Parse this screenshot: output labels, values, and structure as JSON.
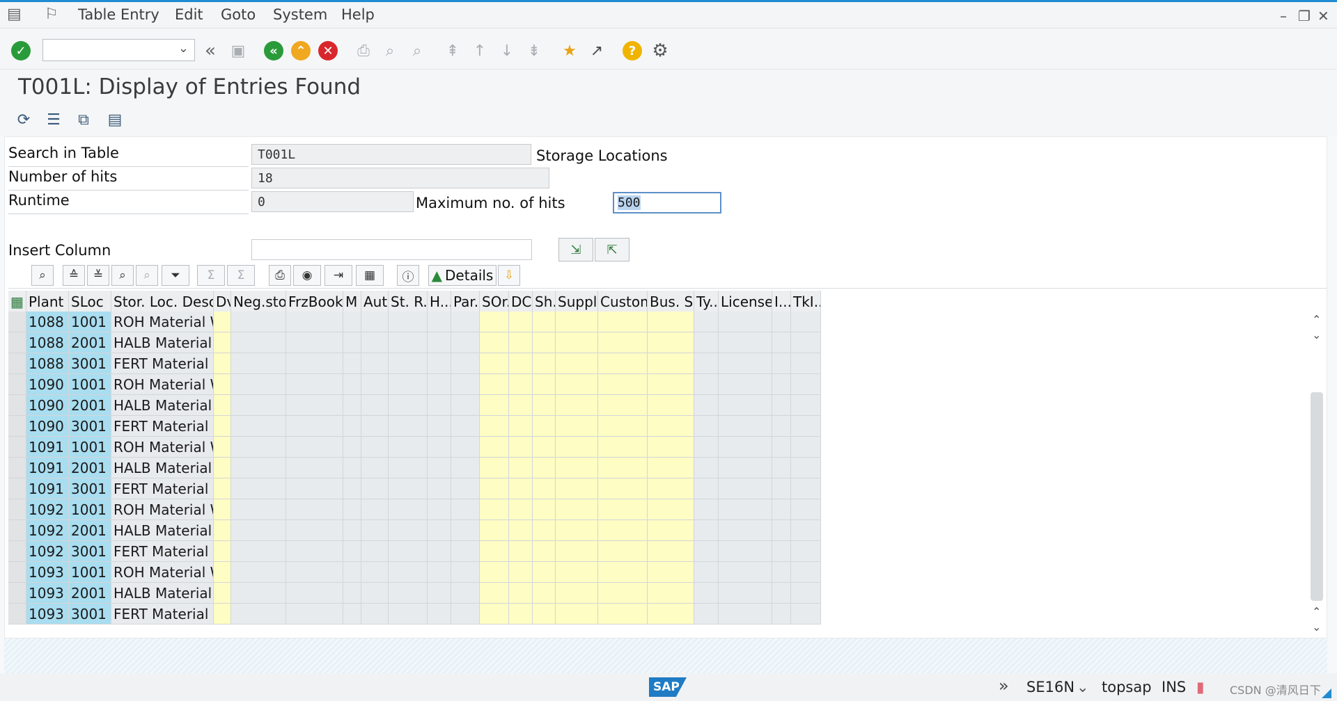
{
  "menubar": {
    "items": [
      "Table Entry",
      "Edit",
      "Goto",
      "System",
      "Help"
    ]
  },
  "window_controls": {
    "minimize": "–",
    "restore": "❐",
    "close": "✕"
  },
  "toolbar": {
    "command_field_value": ""
  },
  "title": "T001L: Display of Entries Found",
  "selection": {
    "search_label": "Search in Table",
    "search_value": "T001L",
    "search_desc": "Storage Locations",
    "hits_label": "Number of hits",
    "hits_value": "18",
    "runtime_label": "Runtime",
    "runtime_value": "0",
    "max_label": "Maximum no. of hits",
    "max_value": "500",
    "insert_label": "Insert Column"
  },
  "alv_toolbar": {
    "details_label": "Details"
  },
  "grid": {
    "columns": [
      "Plant",
      "SLoc",
      "Stor. Loc. Descr.",
      "Dv",
      "Neg.stoc...",
      "FrzBookI...",
      "M",
      "Aut...",
      "St. R...",
      "H...",
      "Par...",
      "SOr...",
      "DC...",
      "Sh...",
      "Suppli...",
      "Custom...",
      "Bus. S...",
      "Ty...",
      "License ...",
      "I...",
      "TkI..."
    ],
    "rows": [
      [
        "1088",
        "1001",
        "ROH Material WH"
      ],
      [
        "1088",
        "2001",
        "HALB Material WH"
      ],
      [
        "1088",
        "3001",
        "FERT Material WH"
      ],
      [
        "1090",
        "1001",
        "ROH Material WH"
      ],
      [
        "1090",
        "2001",
        "HALB Material WH"
      ],
      [
        "1090",
        "3001",
        "FERT Material WH"
      ],
      [
        "1091",
        "1001",
        "ROH Material WH"
      ],
      [
        "1091",
        "2001",
        "HALB Material WH"
      ],
      [
        "1091",
        "3001",
        "FERT Material WH"
      ],
      [
        "1092",
        "1001",
        "ROH Material WH"
      ],
      [
        "1092",
        "2001",
        "HALB Material WH"
      ],
      [
        "1092",
        "3001",
        "FERT Material WH"
      ],
      [
        "1093",
        "1001",
        "ROH Material WH"
      ],
      [
        "1093",
        "2001",
        "HALB Material WH"
      ],
      [
        "1093",
        "3001",
        "FERT Material WH"
      ]
    ]
  },
  "status": {
    "logo": "SAP",
    "transaction": "SE16N",
    "server": "topsap",
    "mode": "INS",
    "watermark": "CSDN @清风日下"
  },
  "colors": {
    "key_column": "#a9ddf0",
    "highlight_column": "#fdfdc4",
    "accent": "#1f8bd2"
  }
}
